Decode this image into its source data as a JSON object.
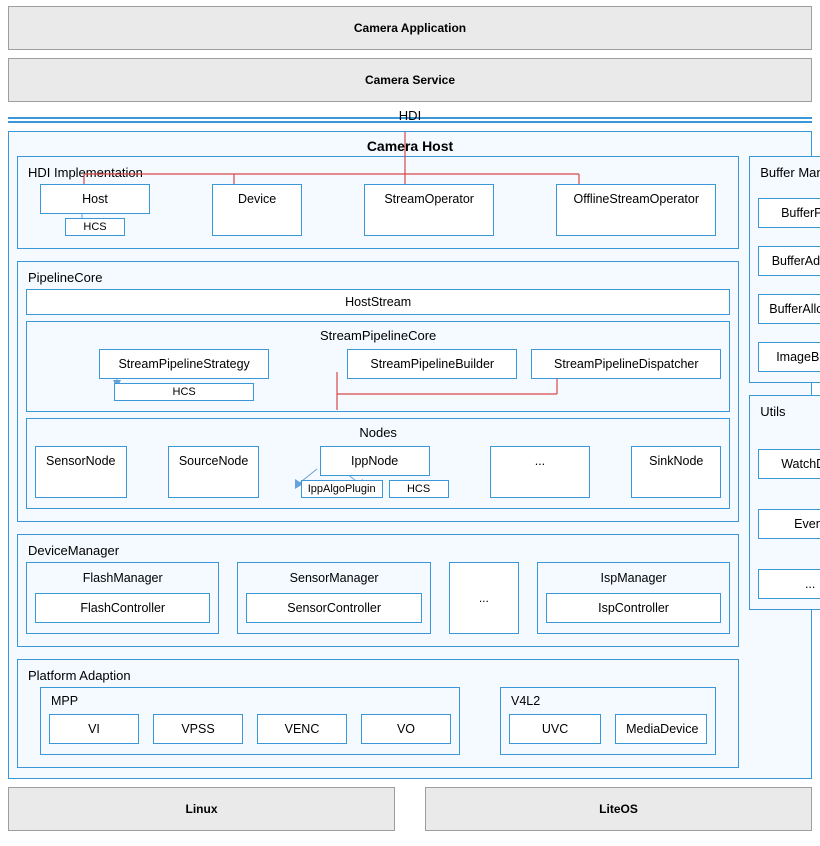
{
  "layers": {
    "app": "Camera Application",
    "service": "Camera Service",
    "hdi_label": "HDI",
    "host_title": "Camera Host",
    "linux": "Linux",
    "liteos": "LiteOS"
  },
  "hdi_impl": {
    "title": "HDI Implementation",
    "host": "Host",
    "device": "Device",
    "stream_operator": "StreamOperator",
    "offline_stream_operator": "OfflineStreamOperator",
    "hcs": "HCS"
  },
  "pipeline": {
    "title": "PipelineCore",
    "host_stream": "HostStream",
    "spc": {
      "title": "StreamPipelineCore",
      "strategy": "StreamPipelineStrategy",
      "builder": "StreamPipelineBuilder",
      "dispatcher": "StreamPipelineDispatcher",
      "hcs": "HCS"
    },
    "nodes": {
      "title": "Nodes",
      "sensor": "SensorNode",
      "source": "SourceNode",
      "ipp": "IppNode",
      "ellipsis": "...",
      "sink": "SinkNode",
      "plugin": "IppAlgoPlugin",
      "hcs": "HCS"
    }
  },
  "device_mgr": {
    "title": "DeviceManager",
    "flash": {
      "title": "FlashManager",
      "ctrl": "FlashController"
    },
    "sensor": {
      "title": "SensorManager",
      "ctrl": "SensorController"
    },
    "isp": {
      "title": "IspManager",
      "ctrl": "IspController"
    },
    "ellipsis": "..."
  },
  "platform": {
    "title": "Platform Adaption",
    "mpp": {
      "title": "MPP",
      "vi": "VI",
      "vpss": "VPSS",
      "venc": "VENC",
      "vo": "VO"
    },
    "v4l2": {
      "title": "V4L2",
      "uvc": "UVC",
      "media": "MediaDevice"
    }
  },
  "buffer_mgr": {
    "title": "Buffer Manager",
    "pool": "BufferPool",
    "adapter": "BufferAdapter",
    "allocator": "BufferAllocator",
    "image": "ImageBuffer"
  },
  "utils": {
    "title": "Utils",
    "watchdog": "WatchDog",
    "event": "Event",
    "ellipsis": "..."
  }
}
